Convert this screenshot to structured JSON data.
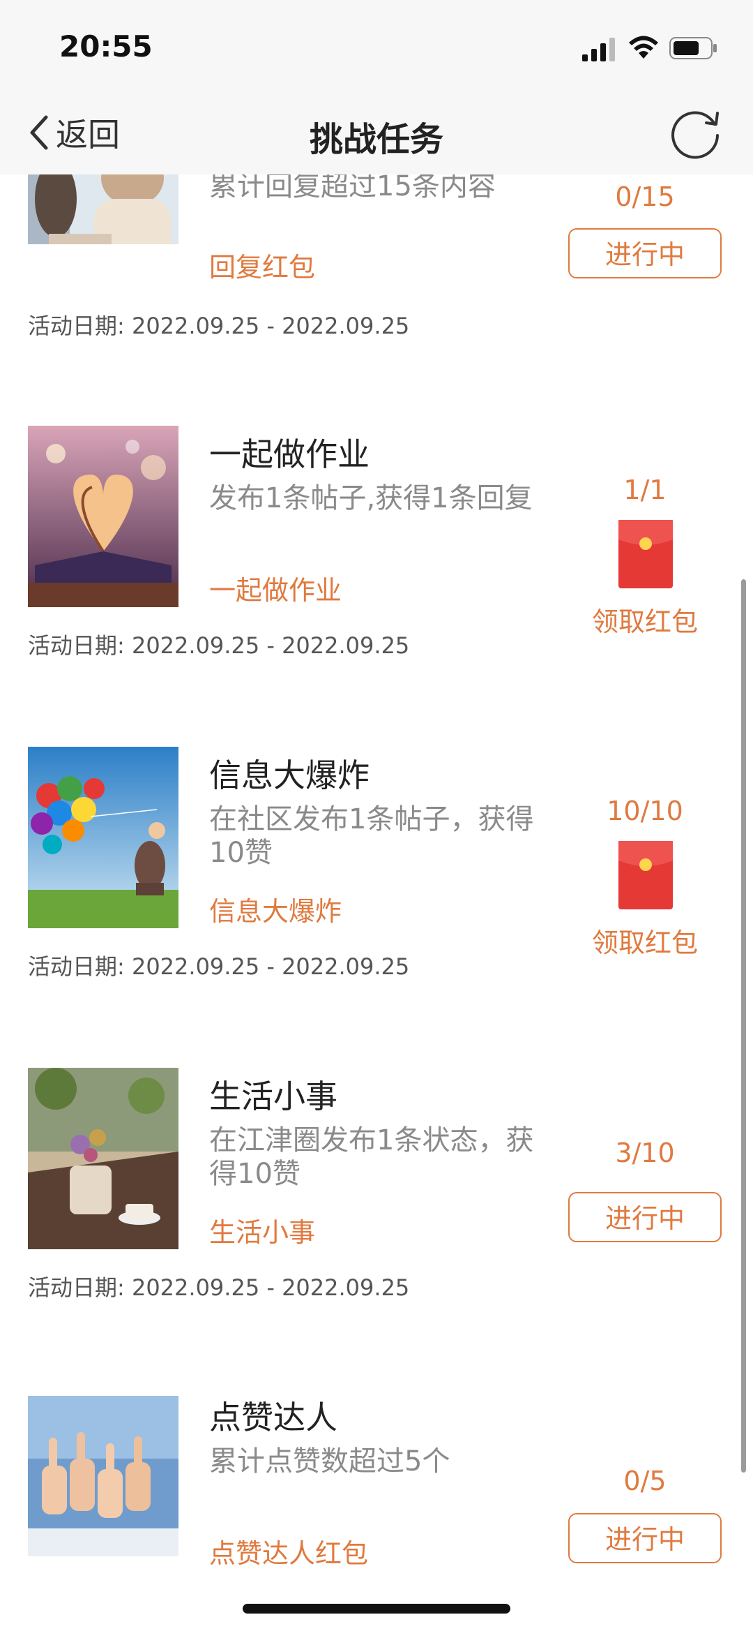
{
  "status": {
    "time": "20:55"
  },
  "nav": {
    "back_label": "返回",
    "title": "挑战任务"
  },
  "colors": {
    "accent": "#e07a3f",
    "red_packet": "#e53935"
  },
  "items": [
    {
      "name": "",
      "desc": "累计回复超过15条内容",
      "tag": "回复红包",
      "date": "活动日期: 2022.09.25 - 2022.09.25",
      "progress": "0/15",
      "status": "进行中",
      "state": "in-progress"
    },
    {
      "name": "一起做作业",
      "desc": "发布1条帖子,获得1条回复",
      "tag": "一起做作业",
      "date": "活动日期: 2022.09.25 - 2022.09.25",
      "progress": "1/1",
      "status": "领取红包",
      "state": "claim"
    },
    {
      "name": "信息大爆炸",
      "desc": "在社区发布1条帖子，获得10赞",
      "tag": "信息大爆炸",
      "date": "活动日期: 2022.09.25 - 2022.09.25",
      "progress": "10/10",
      "status": "领取红包",
      "state": "claim"
    },
    {
      "name": "生活小事",
      "desc": "在江津圈发布1条状态，获得10赞",
      "tag": "生活小事",
      "date": "活动日期: 2022.09.25 - 2022.09.25",
      "progress": "3/10",
      "status": "进行中",
      "state": "in-progress"
    },
    {
      "name": "点赞达人",
      "desc": "累计点赞数超过5个",
      "tag": "点赞达人红包",
      "date": "",
      "progress": "0/5",
      "status": "进行中",
      "state": "in-progress"
    }
  ]
}
